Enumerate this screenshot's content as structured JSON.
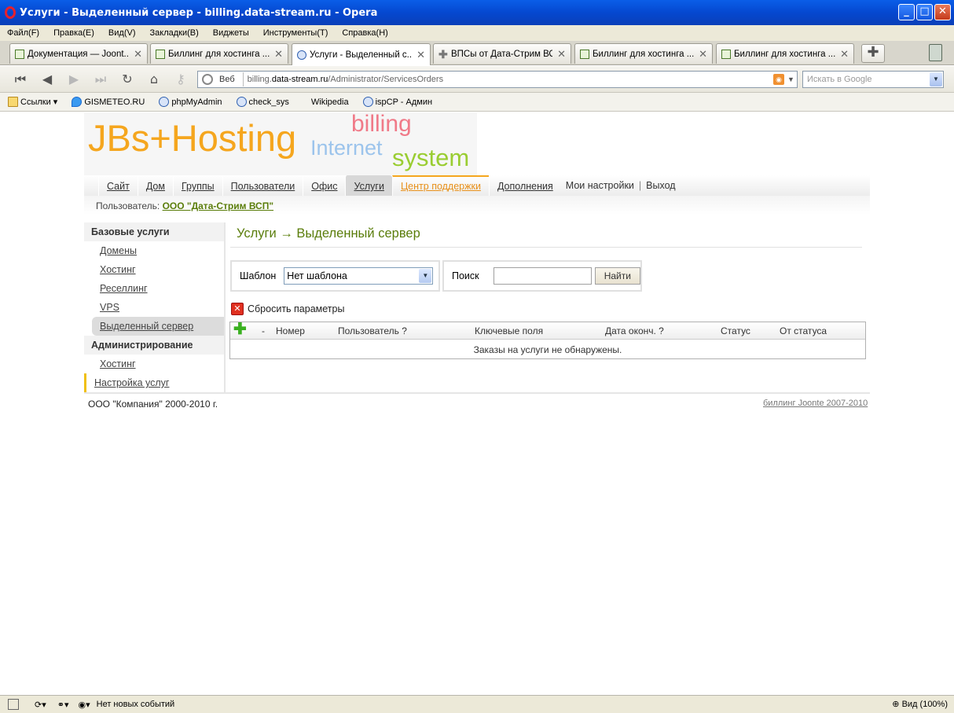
{
  "window": {
    "title": "Услуги - Выделенный сервер - billing.data-stream.ru - Opera",
    "minimize": "_",
    "maximize": "□",
    "close": "✕"
  },
  "menu": [
    "Файл(F)",
    "Правка(E)",
    "Вид(V)",
    "Закладки(B)",
    "Виджеты",
    "Инструменты(T)",
    "Справка(H)"
  ],
  "tabs": [
    {
      "label": "Документация — Joont..."
    },
    {
      "label": "Биллинг для хостинга ..."
    },
    {
      "label": "Услуги - Выделенный с..."
    },
    {
      "label": "ВПСы от Дата-Стрим ВСП"
    },
    {
      "label": "Биллинг для хостинга ..."
    },
    {
      "label": "Биллинг для хостинга ..."
    }
  ],
  "address": {
    "web_label": "Веб",
    "url_prefix": "billing.",
    "url_domain": "data-stream.ru",
    "url_path": "/Administrator/ServicesOrders",
    "search_placeholder": "Искать в Google"
  },
  "bookmarks": [
    "Ссылки",
    "GISMETEO.RU",
    "phpMyAdmin",
    "check_sys",
    "Wikipedia",
    "ispCP - Админ"
  ],
  "logo": {
    "main": "JBs+Hosting",
    "billing": "billing",
    "internet": "Internet",
    "system": "system"
  },
  "topmenu": {
    "site": "Сайт",
    "home": "Дом",
    "groups": "Группы",
    "users": "Пользователи",
    "office": "Офис",
    "services": "Услуги",
    "support": "Центр поддержки",
    "addons": "Дополнения",
    "settings": "Мои настройки",
    "pipe": "|",
    "logout": "Выход"
  },
  "user": {
    "label": "Пользователь:",
    "name": "ООО \"Дата-Стрим ВСП\""
  },
  "sidebar": {
    "group_basic": "Базовые услуги",
    "domains": "Домены",
    "hosting": "Хостинг",
    "reseller": "Реселлинг",
    "vps": "VPS",
    "dedicated": "Выделенный сервер",
    "group_admin": "Администрирование",
    "admin_hosting": "Хостинг",
    "service_settings": "Настройка услуг"
  },
  "main": {
    "title": "Услуги → Выделенный сервер",
    "template_label": "Шаблон",
    "template_value": "Нет шаблона",
    "search_label": "Поиск",
    "search_value": "",
    "find_button": "Найти",
    "reset_label": "Сбросить параметры"
  },
  "grid": {
    "columns": {
      "dash": "-",
      "number": "Номер",
      "user": "Пользователь ?",
      "keys": "Ключевые поля",
      "end_date": "Дата оконч. ?",
      "status": "Статус",
      "from_status": "От статуса"
    },
    "empty": "Заказы на услуги не обнаружены."
  },
  "footer": {
    "copyright": "ООО \"Компания\" 2000-2010 г.",
    "credits": "биллинг Joonte 2007-2010"
  },
  "status": {
    "events": "Нет новых событий",
    "zoom": "Вид (100%)"
  }
}
